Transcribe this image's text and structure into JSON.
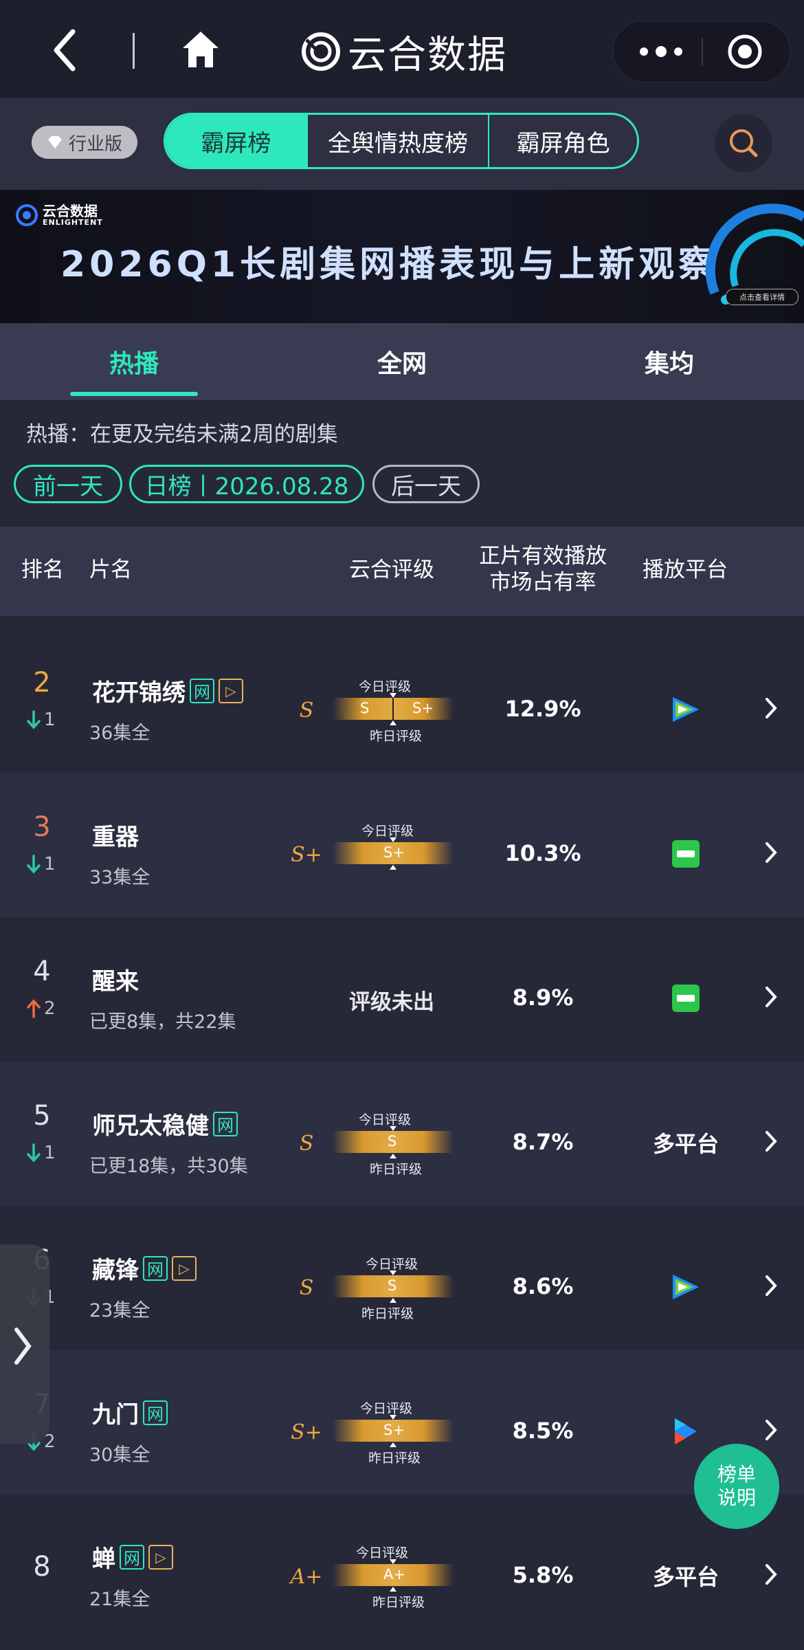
{
  "topbar": {
    "brand": "云合数据"
  },
  "rank_tabs": {
    "industry_label": "行业版",
    "tabs": [
      "霸屏榜",
      "全舆情热度榜",
      "霸屏角色"
    ]
  },
  "banner": {
    "logo_cn": "云合数据",
    "logo_en": "ENLIGHTENT",
    "headline": "2026Q1长剧集网播表现与上新观察",
    "detail_button": "点击查看详情"
  },
  "sub_tabs": [
    "热播",
    "全网",
    "集均"
  ],
  "description": "热播：在更及完结未满2周的剧集",
  "date_nav": {
    "prev": "前一天",
    "current": "日榜丨2026.08.28",
    "next": "后一天"
  },
  "table_header": {
    "rank": "排名",
    "title": "片名",
    "rating": "云合评级",
    "share_line1": "正片有效播放",
    "share_line2": "市场占有率",
    "platform": "播放平台"
  },
  "grade_labels": {
    "today": "今日评级",
    "yesterday": "昨日评级"
  },
  "rows": [
    {
      "rank": "2",
      "change": "1",
      "direction": "down",
      "title": "花开锦绣",
      "tag_net": "网",
      "tag_play": "▷",
      "sub": "36集全",
      "grade": "S",
      "bar_text": "S",
      "bar_text2": "S+",
      "share": "12.9%",
      "platform": "tencent-video-icon"
    },
    {
      "rank": "3",
      "change": "1",
      "direction": "down",
      "title": "重器",
      "sub": "33集全",
      "grade": "S+",
      "bar_text": "S+",
      "share": "10.3%",
      "platform": "iqiyi-icon"
    },
    {
      "rank": "4",
      "change": "2",
      "direction": "up",
      "title": "醒来",
      "sub": "已更8集，共22集",
      "rating_text": "评级未出",
      "share": "8.9%",
      "platform": "iqiyi-icon"
    },
    {
      "rank": "5",
      "change": "1",
      "direction": "down",
      "title": "师兄太稳健",
      "tag_net": "网",
      "sub": "已更18集，共30集",
      "grade": "S",
      "bar_text": "S",
      "share": "8.7%",
      "platform_text": "多平台"
    },
    {
      "rank": "6",
      "change": "1",
      "direction": "down",
      "title": "藏锋",
      "tag_net": "网",
      "tag_play": "▷",
      "sub": "23集全",
      "grade": "S",
      "bar_text": "S",
      "share": "8.6%",
      "platform": "tencent-video-icon"
    },
    {
      "rank": "7",
      "change": "2",
      "direction": "down",
      "title": "九门",
      "tag_net": "网",
      "sub": "30集全",
      "grade": "S+",
      "bar_text": "S+",
      "share": "8.5%",
      "platform": "youku-icon"
    },
    {
      "rank": "8",
      "title": "蝉",
      "tag_net": "网",
      "tag_play": "▷",
      "sub": "21集全",
      "grade": "A+",
      "bar_text": "A+",
      "share": "5.8%",
      "platform_text": "多平台"
    }
  ],
  "fab": {
    "line1": "榜单",
    "line2": "说明"
  },
  "colors": {
    "accent": "#2ee8bd",
    "grade": "#f0a840",
    "down": "#2ec9a0",
    "up": "#f06a3a"
  }
}
